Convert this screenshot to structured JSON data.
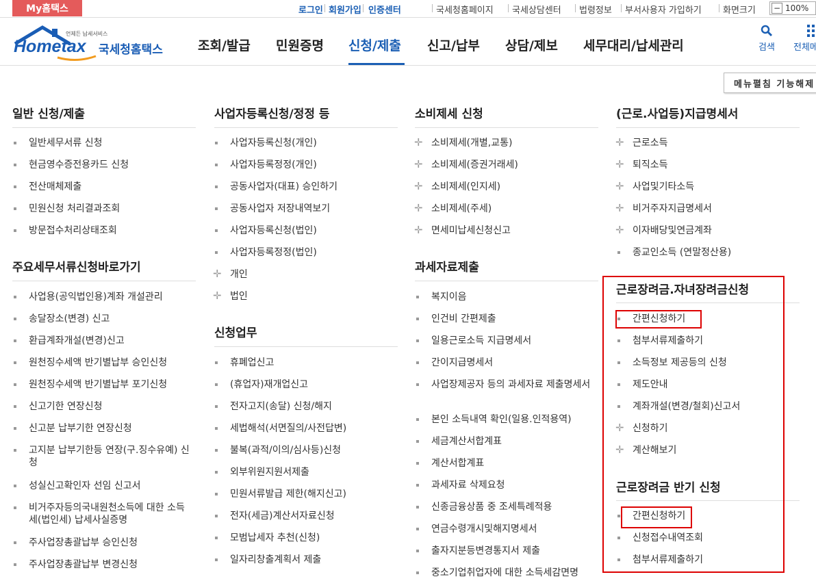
{
  "topbar": {
    "my_label": "My홈택스",
    "links": [
      "로그인",
      "회원가입",
      "인증센터"
    ],
    "gray_links": [
      "국세청홈페이지",
      "국세상담센터",
      "법령정보",
      "부서사용자 가입하기",
      "화면크기"
    ],
    "zoom_value": "100%"
  },
  "header": {
    "logo_tagline": "언제든 납세서비스",
    "logo_main": "Hometax",
    "logo_kor": "국세청홈택스",
    "nav": [
      "조회/발급",
      "민원증명",
      "신청/제출",
      "신고/납부",
      "상담/제보",
      "세무대리/납세관리"
    ],
    "active_nav": "신청/제출",
    "search_label": "검색",
    "all_label": "전체메",
    "collapse_label": "메뉴펼침 기능해제"
  },
  "col1": {
    "sec1": {
      "title": "일반 신청/제출",
      "items": [
        "일반세무서류 신청",
        "현금영수증전용카드 신청",
        "전산매체제출",
        "민원신청 처리결과조회",
        "방문접수처리상태조회"
      ]
    },
    "sec2": {
      "title": "주요세무서류신청바로가기",
      "items": [
        "사업용(공익법인용)계좌 개설관리",
        "송달장소(변경) 신고",
        "환급계좌개설(변경)신고",
        "원천징수세액 반기별납부 승인신청",
        "원천징수세액 반기별납부 포기신청",
        "신고기한 연장신청",
        "신고분 납부기한 연장신청",
        "고지분 납부기한등 연장(구.징수유예) 신청",
        "성실신고확인자 선임 신고서",
        "비거주자등의국내원천소득에 대한 소득세(법인세) 납세사실증명",
        "주사업장총괄납부 승인신청",
        "주사업장총괄납부 변경신청"
      ]
    }
  },
  "col2": {
    "sec1": {
      "title": "사업자등록신청/정정 등",
      "items": [
        "사업자등록신청(개인)",
        "사업자등록정정(개인)",
        "공동사업자(대표) 승인하기",
        "공동사업자 저장내역보기",
        "사업자등록신청(법인)",
        "사업자등록정정(법인)",
        "개인",
        "법인"
      ]
    },
    "sec2": {
      "title": "신청업무",
      "items": [
        "휴폐업신고",
        "(휴업자)재개업신고",
        "전자고지(송달) 신청/해지",
        "세법해석(서면질의/사전답변)",
        "불복(과적/이의/심사등)신청",
        "외부위원지원서제출",
        "민원서류발급 제한(해지신고)",
        "전자(세금)계산서자료신청",
        "모범납세자 추천(신청)",
        "일자리창출계획서 제출"
      ]
    }
  },
  "col3": {
    "sec1": {
      "title": "소비제세 신청",
      "items": [
        "소비제세(개별,교통)",
        "소비제세(증권거래세)",
        "소비제세(인지세)",
        "소비제세(주세)",
        "면세미납세신청신고"
      ]
    },
    "sec2": {
      "title": "과세자료제출",
      "items": [
        "복지이음",
        "인건비 간편제출",
        "일용근로소득 지급명세서",
        "간이지급명세서",
        "사업장제공자 등의 과세자료 제출명세서",
        "본인 소득내역 확인(일용.인적용역)",
        "세금계산서합계표",
        "계산서합계표",
        "과세자료 삭제요청",
        "신종금융상품 중 조세특례적용",
        "연금수령개시및해지명세서",
        "출자지분등변경통지서 제출",
        "중소기업취업자에 대한 소득세감면명"
      ]
    }
  },
  "col4": {
    "sec1": {
      "title": "(근로.사업등)지급명세서",
      "items": [
        "근로소득",
        "퇴직소득",
        "사업및기타소득",
        "비거주자지급명세서",
        "이자배당및연금계좌",
        "종교인소득 (연말정산용)"
      ]
    },
    "sec2": {
      "title": "근로장려금.자녀장려금신청",
      "items": [
        "간편신청하기",
        "첨부서류제출하기",
        "소득정보 제공등의 신청",
        "제도안내",
        "계좌개설(변경/철회)신고서",
        "신청하기",
        "계산해보기"
      ]
    },
    "sec3": {
      "title": "근로장려금 반기 신청",
      "items": [
        "간편신청하기",
        "신청접수내역조회",
        "첨부서류제출하기"
      ]
    }
  },
  "colors": {
    "accent": "#1b5fb4",
    "my_bg": "#e45b5b",
    "highlight": "#dd0000"
  }
}
